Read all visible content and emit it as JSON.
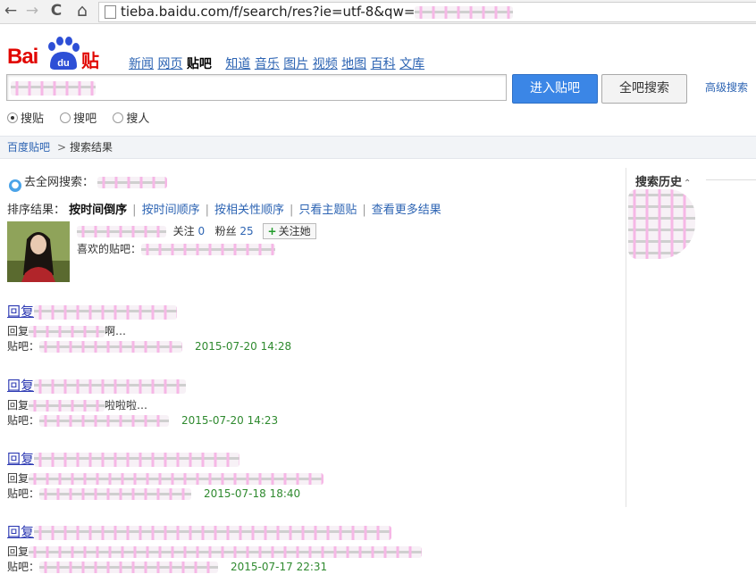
{
  "browser": {
    "back_icon": "←",
    "forward_icon": "→",
    "reload_icon": "C",
    "home_icon": "⌂",
    "url": "tieba.baidu.com/f/search/res?ie=utf-8&qw="
  },
  "header": {
    "logo_bai": "Bai",
    "logo_du": "du",
    "logo_tieba": "贴吧",
    "nav": [
      "新闻",
      "网页",
      "贴吧",
      "知道",
      "音乐",
      "图片",
      "视频",
      "地图",
      "百科",
      "文库"
    ],
    "enter_button": "进入贴吧",
    "all_search_button": "全吧搜索",
    "advanced_search": "高级搜索",
    "radio_options": [
      "搜贴",
      "搜吧",
      "搜人"
    ],
    "radio_selected": 0
  },
  "breadcrumb": {
    "home": "百度贴吧",
    "separator": ">",
    "current": "搜索结果"
  },
  "main": {
    "web_search_label": "去全网搜索：",
    "sort_label": "排序结果：",
    "sort_options": [
      "按时间倒序",
      "按时间顺序",
      "按相关性顺序",
      "只看主题贴",
      "查看更多结果"
    ],
    "user": {
      "follow_label": "关注",
      "follow_count": "0",
      "fans_label": "粉丝",
      "fans_count": "25",
      "follow_button": "关注她",
      "fav_label": "喜欢的贴吧："
    },
    "results": [
      {
        "title_prefix": "回复",
        "body_prefix": "回复",
        "body_suffix": "啊…",
        "forum_label": "贴吧：",
        "date": "2015-07-20 14:28"
      },
      {
        "title_prefix": "回复",
        "body_prefix": "回复",
        "body_suffix": "啦啦啦…",
        "forum_label": "贴吧：",
        "date": "2015-07-20 14:23"
      },
      {
        "title_prefix": "回复",
        "body_prefix": "回复",
        "body_suffix": "",
        "forum_label": "贴吧：",
        "date": "2015-07-18 18:40"
      },
      {
        "title_prefix": "回复",
        "body_prefix": "回复",
        "body_suffix": "",
        "forum_label": "贴吧：",
        "date": "2015-07-17 22:31"
      }
    ]
  },
  "sidebar": {
    "history_title": "搜索历史",
    "caret": "⌃"
  },
  "colors": {
    "brand_red": "#e10601",
    "link_blue": "#2d64b3",
    "button_blue": "#3b86e6",
    "date_green": "#2f8a2f"
  }
}
